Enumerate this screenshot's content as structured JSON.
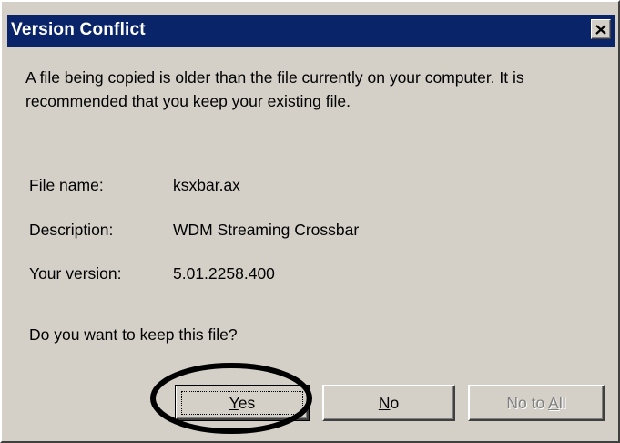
{
  "window": {
    "title": "Version Conflict",
    "close_icon": "close-icon"
  },
  "message": {
    "text": "A file being copied is older than the file currently on your computer. It is recommended that you keep your existing file."
  },
  "details": {
    "file_name_label": "File name:",
    "file_name_value": "ksxbar.ax",
    "description_label": "Description:",
    "description_value": "WDM Streaming Crossbar",
    "version_label": "Your version:",
    "version_value": "5.01.2258.400"
  },
  "question": "Do you want to keep this file?",
  "buttons": {
    "yes_mnemonic": "Y",
    "yes_rest": "es",
    "no_mnemonic": "N",
    "no_rest": "o",
    "noall_prefix": "No to ",
    "noall_mnemonic": "A",
    "noall_rest": "ll"
  },
  "colors": {
    "titlebar": "#0a246a",
    "dialog_face": "#d4d0c8",
    "disabled_text": "#808080",
    "annotation": "#000000"
  }
}
